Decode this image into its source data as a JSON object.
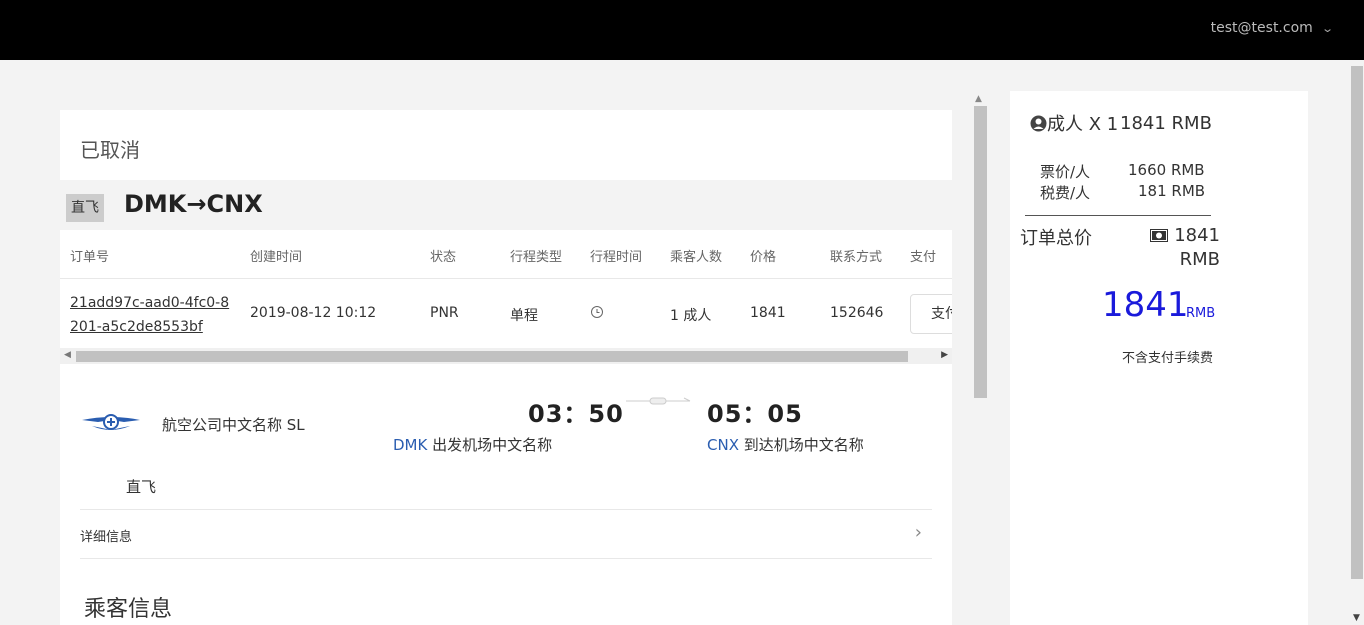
{
  "header": {
    "user_email": "test@test.com"
  },
  "order": {
    "status": "已取消",
    "type_tag": "直飞",
    "route": "DMK→CNX",
    "columns": [
      "订单号",
      "创建时间",
      "状态",
      "行程类型",
      "行程时间",
      "乘客人数",
      "价格",
      "联系方式",
      "支付"
    ],
    "row": {
      "order_no": "21add97c-aad0-4fc0-8201-a5c2de8553bf",
      "created": "2019-08-12 10:12",
      "status": "PNR",
      "trip_type": "单程",
      "trip_time_icon": "clock-icon",
      "passengers": "1 成人",
      "price": "1841",
      "contact": "152646",
      "pay_label": "支付"
    }
  },
  "flight": {
    "airline": "航空公司中文名称 SL",
    "dep_time": "03：50",
    "arr_time": "05：05",
    "dep_code": "DMK",
    "dep_airport": "出发机场中文名称",
    "arr_code": "CNX",
    "arr_airport": "到达机场中文名称",
    "direct": "直飞",
    "detail_label": "详细信息",
    "passenger_title": "乘客信息"
  },
  "price": {
    "adult_label": "成人 X 1",
    "adult_price": "1841 RMB",
    "ticket_label": "票价/人",
    "ticket_value": "1660 RMB",
    "tax_label": "税费/人",
    "tax_value": "181 RMB",
    "total_label": "订单总价",
    "total_value": "1841 RMB",
    "big_total": "1841",
    "big_unit": "RMB",
    "fee_note": "不含支付手续费"
  },
  "colors": {
    "accent": "#1a1adb",
    "link": "#5b2a86",
    "code": "#2a5db0"
  }
}
